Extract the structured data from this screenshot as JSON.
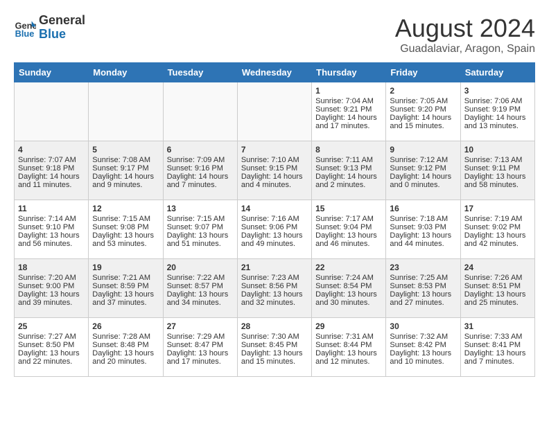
{
  "logo": {
    "line1": "General",
    "line2": "Blue"
  },
  "title": "August 2024",
  "location": "Guadalaviar, Aragon, Spain",
  "days_of_week": [
    "Sunday",
    "Monday",
    "Tuesday",
    "Wednesday",
    "Thursday",
    "Friday",
    "Saturday"
  ],
  "weeks": [
    [
      {
        "day": "",
        "info": ""
      },
      {
        "day": "",
        "info": ""
      },
      {
        "day": "",
        "info": ""
      },
      {
        "day": "",
        "info": ""
      },
      {
        "day": "1",
        "sunrise": "7:04 AM",
        "sunset": "9:21 PM",
        "daylight": "14 hours and 17 minutes."
      },
      {
        "day": "2",
        "sunrise": "7:05 AM",
        "sunset": "9:20 PM",
        "daylight": "14 hours and 15 minutes."
      },
      {
        "day": "3",
        "sunrise": "7:06 AM",
        "sunset": "9:19 PM",
        "daylight": "14 hours and 13 minutes."
      }
    ],
    [
      {
        "day": "4",
        "sunrise": "7:07 AM",
        "sunset": "9:18 PM",
        "daylight": "14 hours and 11 minutes."
      },
      {
        "day": "5",
        "sunrise": "7:08 AM",
        "sunset": "9:17 PM",
        "daylight": "14 hours and 9 minutes."
      },
      {
        "day": "6",
        "sunrise": "7:09 AM",
        "sunset": "9:16 PM",
        "daylight": "14 hours and 7 minutes."
      },
      {
        "day": "7",
        "sunrise": "7:10 AM",
        "sunset": "9:15 PM",
        "daylight": "14 hours and 4 minutes."
      },
      {
        "day": "8",
        "sunrise": "7:11 AM",
        "sunset": "9:13 PM",
        "daylight": "14 hours and 2 minutes."
      },
      {
        "day": "9",
        "sunrise": "7:12 AM",
        "sunset": "9:12 PM",
        "daylight": "14 hours and 0 minutes."
      },
      {
        "day": "10",
        "sunrise": "7:13 AM",
        "sunset": "9:11 PM",
        "daylight": "13 hours and 58 minutes."
      }
    ],
    [
      {
        "day": "11",
        "sunrise": "7:14 AM",
        "sunset": "9:10 PM",
        "daylight": "13 hours and 56 minutes."
      },
      {
        "day": "12",
        "sunrise": "7:15 AM",
        "sunset": "9:08 PM",
        "daylight": "13 hours and 53 minutes."
      },
      {
        "day": "13",
        "sunrise": "7:15 AM",
        "sunset": "9:07 PM",
        "daylight": "13 hours and 51 minutes."
      },
      {
        "day": "14",
        "sunrise": "7:16 AM",
        "sunset": "9:06 PM",
        "daylight": "13 hours and 49 minutes."
      },
      {
        "day": "15",
        "sunrise": "7:17 AM",
        "sunset": "9:04 PM",
        "daylight": "13 hours and 46 minutes."
      },
      {
        "day": "16",
        "sunrise": "7:18 AM",
        "sunset": "9:03 PM",
        "daylight": "13 hours and 44 minutes."
      },
      {
        "day": "17",
        "sunrise": "7:19 AM",
        "sunset": "9:02 PM",
        "daylight": "13 hours and 42 minutes."
      }
    ],
    [
      {
        "day": "18",
        "sunrise": "7:20 AM",
        "sunset": "9:00 PM",
        "daylight": "13 hours and 39 minutes."
      },
      {
        "day": "19",
        "sunrise": "7:21 AM",
        "sunset": "8:59 PM",
        "daylight": "13 hours and 37 minutes."
      },
      {
        "day": "20",
        "sunrise": "7:22 AM",
        "sunset": "8:57 PM",
        "daylight": "13 hours and 34 minutes."
      },
      {
        "day": "21",
        "sunrise": "7:23 AM",
        "sunset": "8:56 PM",
        "daylight": "13 hours and 32 minutes."
      },
      {
        "day": "22",
        "sunrise": "7:24 AM",
        "sunset": "8:54 PM",
        "daylight": "13 hours and 30 minutes."
      },
      {
        "day": "23",
        "sunrise": "7:25 AM",
        "sunset": "8:53 PM",
        "daylight": "13 hours and 27 minutes."
      },
      {
        "day": "24",
        "sunrise": "7:26 AM",
        "sunset": "8:51 PM",
        "daylight": "13 hours and 25 minutes."
      }
    ],
    [
      {
        "day": "25",
        "sunrise": "7:27 AM",
        "sunset": "8:50 PM",
        "daylight": "13 hours and 22 minutes."
      },
      {
        "day": "26",
        "sunrise": "7:28 AM",
        "sunset": "8:48 PM",
        "daylight": "13 hours and 20 minutes."
      },
      {
        "day": "27",
        "sunrise": "7:29 AM",
        "sunset": "8:47 PM",
        "daylight": "13 hours and 17 minutes."
      },
      {
        "day": "28",
        "sunrise": "7:30 AM",
        "sunset": "8:45 PM",
        "daylight": "13 hours and 15 minutes."
      },
      {
        "day": "29",
        "sunrise": "7:31 AM",
        "sunset": "8:44 PM",
        "daylight": "13 hours and 12 minutes."
      },
      {
        "day": "30",
        "sunrise": "7:32 AM",
        "sunset": "8:42 PM",
        "daylight": "13 hours and 10 minutes."
      },
      {
        "day": "31",
        "sunrise": "7:33 AM",
        "sunset": "8:41 PM",
        "daylight": "13 hours and 7 minutes."
      }
    ]
  ],
  "labels": {
    "sunrise": "Sunrise:",
    "sunset": "Sunset:",
    "daylight": "Daylight:"
  }
}
